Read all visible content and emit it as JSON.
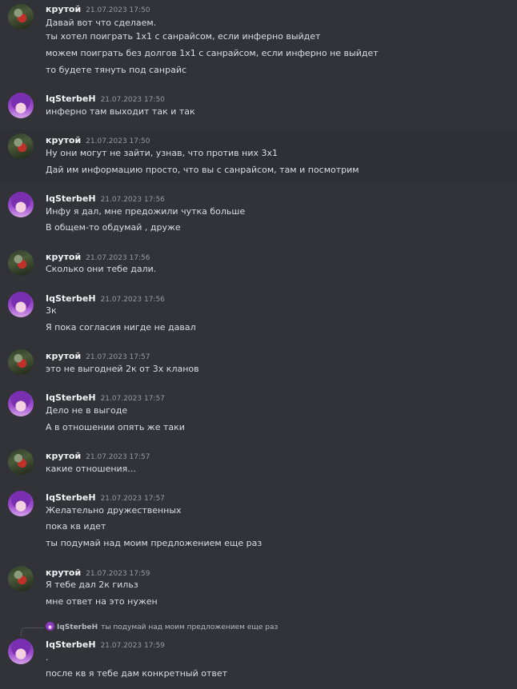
{
  "messages": [
    {
      "author": "крутой",
      "time": "21.07.2023 17:50",
      "avatar": "joker-avatar",
      "lines": [
        "Давай вот что сделаем.",
        "ты хотел поиграть 1х1 с санрайсом, если инферно выйдет",
        "можем поиграть без долгов 1х1 с санрайсом, если инферно не выйдет",
        "то будете тянуть под санрайс"
      ]
    },
    {
      "author": "IqSterbeH",
      "time": "21.07.2023 17:50",
      "avatar": "purple-avatar",
      "lines": [
        "инферно там выходит так и так"
      ]
    },
    {
      "author": "крутой",
      "time": "21.07.2023 17:50",
      "avatar": "joker-avatar",
      "lines": [
        "Ну они могут не зайти, узнав, что против них 3х1",
        "Дай им информацию просто, что вы с санрайсом, там и посмотрим"
      ]
    },
    {
      "author": "IqSterbeH",
      "time": "21.07.2023 17:56",
      "avatar": "purple-avatar",
      "lines": [
        "Инфу я дал, мне предожили чутка больше",
        "В общем-то обдумай , друже"
      ]
    },
    {
      "author": "крутой",
      "time": "21.07.2023 17:56",
      "avatar": "joker-avatar",
      "lines": [
        "Сколько они тебе дали."
      ]
    },
    {
      "author": "IqSterbeH",
      "time": "21.07.2023 17:56",
      "avatar": "purple-avatar",
      "lines": [
        "3к",
        "Я пока согласия нигде не давал"
      ]
    },
    {
      "author": "крутой",
      "time": "21.07.2023 17:57",
      "avatar": "joker-avatar",
      "lines": [
        "это не выгодней 2к от 3х кланов"
      ]
    },
    {
      "author": "IqSterbeH",
      "time": "21.07.2023 17:57",
      "avatar": "purple-avatar",
      "lines": [
        "Дело не в выгоде",
        "А в отношении опять же таки"
      ]
    },
    {
      "author": "крутой",
      "time": "21.07.2023 17:57",
      "avatar": "joker-avatar",
      "lines": [
        "какие отношения..."
      ]
    },
    {
      "author": "IqSterbeH",
      "time": "21.07.2023 17:57",
      "avatar": "purple-avatar",
      "lines": [
        "Желательно дружественных",
        "пока кв идет",
        "ты подумай над моим предложением еще раз"
      ]
    },
    {
      "author": "крутой",
      "time": "21.07.2023 17:59",
      "avatar": "joker-avatar",
      "lines": [
        "Я тебе дал 2к гильз",
        "мне ответ на это нужен"
      ]
    },
    {
      "author": "IqSterbeH",
      "time": "21.07.2023 17:59",
      "avatar": "purple-avatar",
      "lines": [
        ".",
        "после кв я тебе дам конкретный ответ"
      ]
    }
  ],
  "reply": {
    "author": "IqSterbeH",
    "text": "ты подумай над моим предложением еще раз"
  }
}
